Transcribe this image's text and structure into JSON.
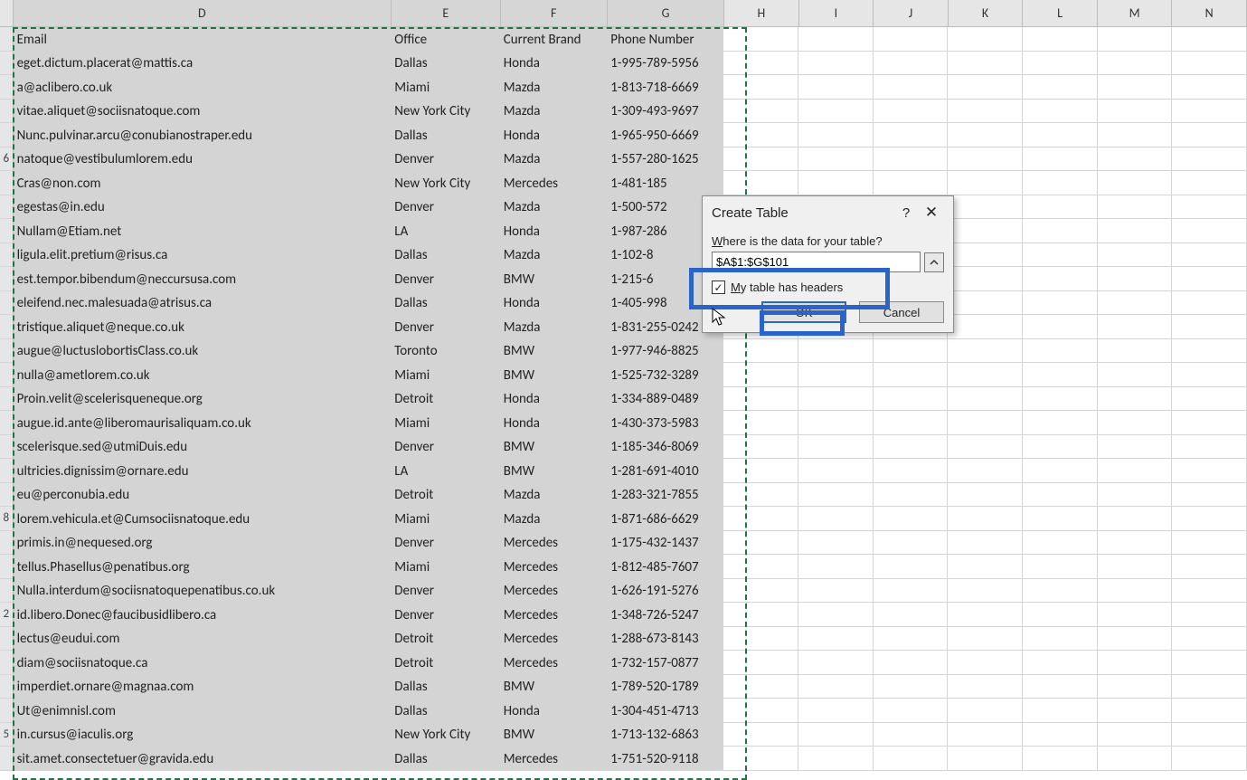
{
  "columns": [
    "D",
    "E",
    "F",
    "G",
    "H",
    "I",
    "J",
    "K",
    "L",
    "M",
    "N"
  ],
  "headers": {
    "D": "Email",
    "E": "Office",
    "F": "Current Brand",
    "G": "Phone Number"
  },
  "rows": [
    {
      "n": "",
      "D": "eget.dictum.placerat@mattis.ca",
      "E": "Dallas",
      "F": "Honda",
      "G": "1-995-789-5956"
    },
    {
      "n": "",
      "D": "a@aclibero.co.uk",
      "E": "Miami",
      "F": "Mazda",
      "G": "1-813-718-6669"
    },
    {
      "n": "",
      "D": "vitae.aliquet@sociisnatoque.com",
      "E": "New York City",
      "F": "Mazda",
      "G": "1-309-493-9697"
    },
    {
      "n": "",
      "D": "Nunc.pulvinar.arcu@conubianostraper.edu",
      "E": "Dallas",
      "F": "Honda",
      "G": "1-965-950-6669"
    },
    {
      "n": "6",
      "D": "natoque@vestibulumlorem.edu",
      "E": "Denver",
      "F": "Mazda",
      "G": "1-557-280-1625"
    },
    {
      "n": "",
      "D": "Cras@non.com",
      "E": "New York City",
      "F": "Mercedes",
      "G": "1-481-185"
    },
    {
      "n": "",
      "D": "egestas@in.edu",
      "E": "Denver",
      "F": "Mazda",
      "G": "1-500-572"
    },
    {
      "n": "",
      "D": "Nullam@Etiam.net",
      "E": "LA",
      "F": "Honda",
      "G": "1-987-286"
    },
    {
      "n": "",
      "D": "ligula.elit.pretium@risus.ca",
      "E": "Dallas",
      "F": "Mazda",
      "G": "1-102-8"
    },
    {
      "n": "",
      "D": "est.tempor.bibendum@neccursusa.com",
      "E": "Denver",
      "F": "BMW",
      "G": "1-215-6"
    },
    {
      "n": "",
      "D": "eleifend.nec.malesuada@atrisus.ca",
      "E": "Dallas",
      "F": "Honda",
      "G": "1-405-998"
    },
    {
      "n": "",
      "D": "tristique.aliquet@neque.co.uk",
      "E": "Denver",
      "F": "Mazda",
      "G": "1-831-255-0242"
    },
    {
      "n": "",
      "D": "augue@luctuslobortisClass.co.uk",
      "E": "Toronto",
      "F": "BMW",
      "G": "1-977-946-8825"
    },
    {
      "n": "",
      "D": "nulla@ametlorem.co.uk",
      "E": "Miami",
      "F": "BMW",
      "G": "1-525-732-3289"
    },
    {
      "n": "",
      "D": "Proin.velit@scelerisqueneque.org",
      "E": "Detroit",
      "F": "Honda",
      "G": "1-334-889-0489"
    },
    {
      "n": "",
      "D": "augue.id.ante@liberomaurisaliquam.co.uk",
      "E": "Miami",
      "F": "Honda",
      "G": "1-430-373-5983"
    },
    {
      "n": "",
      "D": "scelerisque.sed@utmiDuis.edu",
      "E": "Denver",
      "F": "BMW",
      "G": "1-185-346-8069"
    },
    {
      "n": "",
      "D": "ultricies.dignissim@ornare.edu",
      "E": "LA",
      "F": "BMW",
      "G": "1-281-691-4010"
    },
    {
      "n": "",
      "D": "eu@perconubia.edu",
      "E": "Detroit",
      "F": "Mazda",
      "G": "1-283-321-7855"
    },
    {
      "n": "8",
      "D": "lorem.vehicula.et@Cumsociisnatoque.edu",
      "E": "Miami",
      "F": "Mazda",
      "G": "1-871-686-6629"
    },
    {
      "n": "",
      "D": "primis.in@nequesed.org",
      "E": "Denver",
      "F": "Mercedes",
      "G": "1-175-432-1437"
    },
    {
      "n": "",
      "D": "tellus.Phasellus@penatibus.org",
      "E": "Miami",
      "F": "Mercedes",
      "G": "1-812-485-7607"
    },
    {
      "n": "",
      "D": "Nulla.interdum@sociisnatoquepenatibus.co.uk",
      "E": "Denver",
      "F": "Mercedes",
      "G": "1-626-191-5276"
    },
    {
      "n": "2",
      "D": "id.libero.Donec@faucibusidlibero.ca",
      "E": "Denver",
      "F": "Mercedes",
      "G": "1-348-726-5247"
    },
    {
      "n": "",
      "D": "lectus@eudui.com",
      "E": "Detroit",
      "F": "Mercedes",
      "G": "1-288-673-8143"
    },
    {
      "n": "",
      "D": "diam@sociisnatoque.ca",
      "E": "Detroit",
      "F": "Mercedes",
      "G": "1-732-157-0877"
    },
    {
      "n": "",
      "D": "imperdiet.ornare@magnaa.com",
      "E": "Dallas",
      "F": "BMW",
      "G": "1-789-520-1789"
    },
    {
      "n": "",
      "D": "Ut@enimnisl.com",
      "E": "Dallas",
      "F": "Honda",
      "G": "1-304-451-4713"
    },
    {
      "n": "5",
      "D": "in.cursus@iaculis.org",
      "E": "New York City",
      "F": "BMW",
      "G": "1-713-132-6863"
    },
    {
      "n": "",
      "D": "sit.amet.consectetuer@gravida.edu",
      "E": "Dallas",
      "F": "Mercedes",
      "G": "1-751-520-9118"
    }
  ],
  "dialog": {
    "title": "Create Table",
    "prompt_pre": "W",
    "prompt_rest": "here is the data for your table?",
    "range": "$A$1:$G$101",
    "checkbox_pre": "M",
    "checkbox_rest": "y table has headers",
    "ok": "OK",
    "cancel": "Cancel"
  }
}
